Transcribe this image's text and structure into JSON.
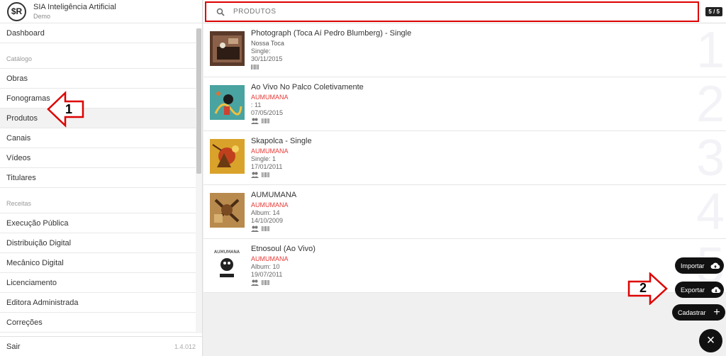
{
  "brand": {
    "logo_text": "$R",
    "name": "SIA Inteligência Artificial",
    "subtitle": "Demo"
  },
  "sidebar": {
    "items": [
      {
        "label": "Dashboard",
        "type": "item"
      },
      {
        "label": "Catálogo",
        "type": "section"
      },
      {
        "label": "Obras",
        "type": "item"
      },
      {
        "label": "Fonogramas",
        "type": "item"
      },
      {
        "label": "Produtos",
        "type": "item",
        "active": true
      },
      {
        "label": "Canais",
        "type": "item"
      },
      {
        "label": "Vídeos",
        "type": "item"
      },
      {
        "label": "Titulares",
        "type": "item"
      },
      {
        "label": "Receitas",
        "type": "section"
      },
      {
        "label": "Execução Pública",
        "type": "item"
      },
      {
        "label": "Distribuição Digital",
        "type": "item"
      },
      {
        "label": "Mecânico Digital",
        "type": "item"
      },
      {
        "label": "Licenciamento",
        "type": "item"
      },
      {
        "label": "Editora Administrada",
        "type": "item"
      },
      {
        "label": "Correções",
        "type": "item"
      }
    ],
    "footer": {
      "exit": "Sair",
      "version": "1.4.012"
    }
  },
  "annotations": {
    "arrow1": "1",
    "arrow2": "2"
  },
  "search": {
    "placeholder": "PRODUTOS",
    "counter": "5 / 5"
  },
  "products": [
    {
      "title": "Photograph (Toca Aí Pedro Blumberg) - Single",
      "artist": "Nossa Toca",
      "artist_red": false,
      "type_line": "Single:",
      "date": "30/11/2015",
      "people_icon": false,
      "index": "1"
    },
    {
      "title": "Ao Vivo No Palco Coletivamente",
      "artist": "AUMUMANA",
      "artist_red": true,
      "type_line": ": 11",
      "date": "07/05/2015",
      "people_icon": true,
      "index": "2"
    },
    {
      "title": "Skapolca - Single",
      "artist": "AUMUMANA",
      "artist_red": true,
      "type_line": "Single: 1",
      "date": "17/01/2011",
      "people_icon": true,
      "index": "3"
    },
    {
      "title": "AUMUMANA",
      "artist": "AUMUMANA",
      "artist_red": true,
      "type_line": "Album: 14",
      "date": "14/10/2009",
      "people_icon": true,
      "index": "4"
    },
    {
      "title": "Etnosoul (Ao Vivo)",
      "artist": "AUMUMANA",
      "artist_red": true,
      "type_line": "Album: 10",
      "date": "19/07/2011",
      "people_icon": true,
      "index": "5"
    }
  ],
  "fab": {
    "import": "Importar",
    "export": "Exportar",
    "create": "Cadastrar",
    "close": "×"
  },
  "colors": {
    "accent_red": "#e53935",
    "annotation_red": "#dd0000",
    "fab_bg": "#111111"
  }
}
